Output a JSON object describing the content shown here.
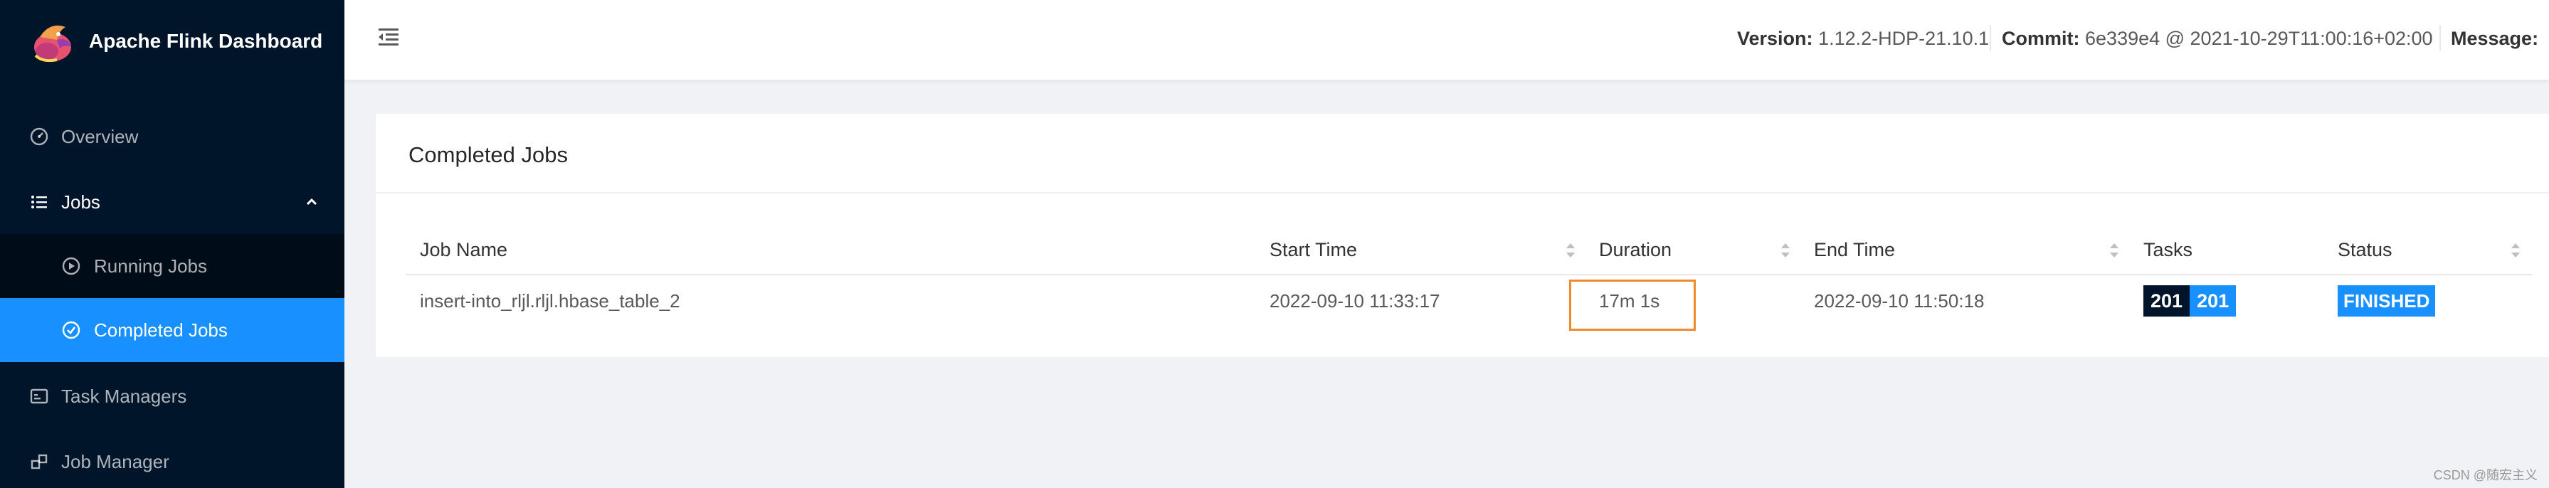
{
  "brand": {
    "title": "Apache Flink Dashboard"
  },
  "sidebar": {
    "items": [
      {
        "label": "Overview",
        "icon": "dashboard-icon"
      },
      {
        "label": "Jobs",
        "icon": "list-icon",
        "expanded": true,
        "children": [
          {
            "label": "Running Jobs",
            "icon": "play-circle-icon"
          },
          {
            "label": "Completed Jobs",
            "icon": "check-circle-icon",
            "selected": true
          }
        ]
      },
      {
        "label": "Task Managers",
        "icon": "schedule-icon"
      },
      {
        "label": "Job Manager",
        "icon": "build-icon"
      }
    ]
  },
  "header": {
    "version_label": "Version:",
    "version_value": "1.12.2-HDP-21.10.1",
    "commit_label": "Commit:",
    "commit_value": "6e339e4 @ 2021-10-29T11:00:16+02:00",
    "message_label": "Message:"
  },
  "card": {
    "title": "Completed Jobs",
    "columns": [
      "Job Name",
      "Start Time",
      "Duration",
      "End Time",
      "Tasks",
      "Status"
    ],
    "rows": [
      {
        "job_name": "insert-into_rljl.rljl.hbase_table_2",
        "start_time": "2022-09-10 11:33:17",
        "duration": "17m 1s",
        "end_time": "2022-09-10 11:50:18",
        "tasks_total": "201",
        "tasks_finished": "201",
        "status": "FINISHED"
      }
    ]
  },
  "colors": {
    "sidebar_bg": "#001529",
    "submenu_bg": "#000c17",
    "accent": "#1890ff",
    "highlight_box": "#f08a2c"
  },
  "watermark": "CSDN @随宏主义"
}
